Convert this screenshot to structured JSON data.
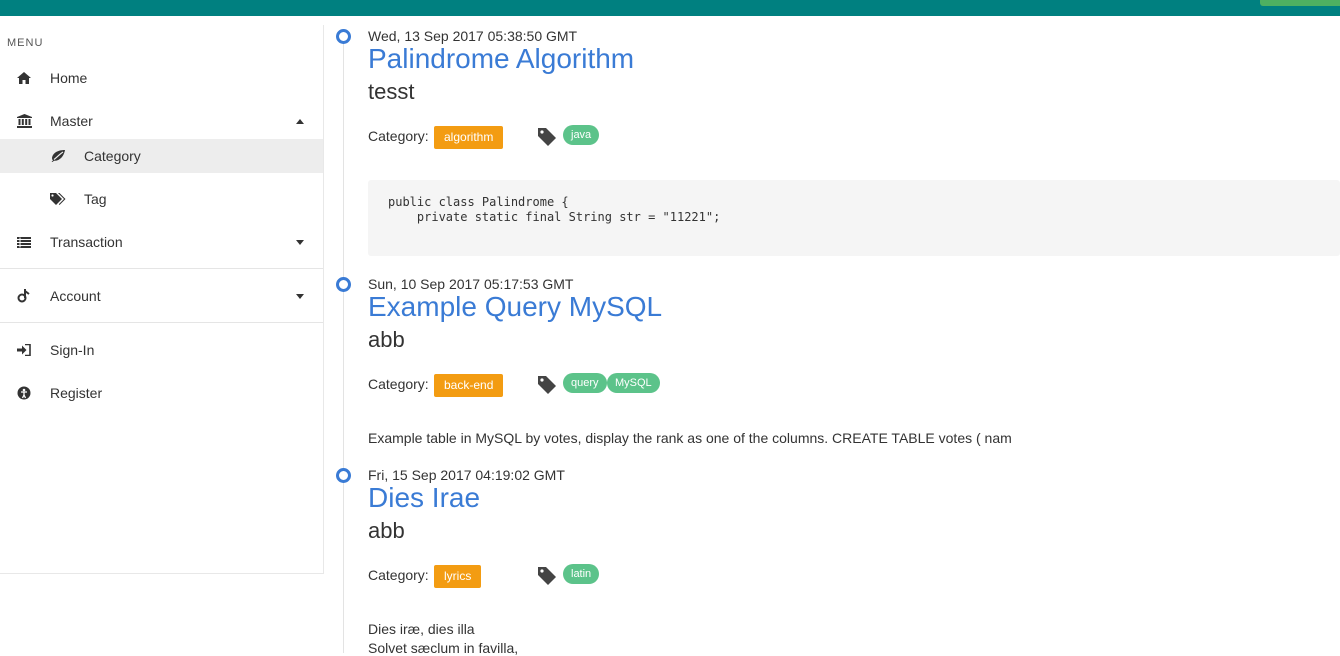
{
  "sidebar": {
    "menu_header": "MENU",
    "items": [
      {
        "label": "Home",
        "icon": "home-icon"
      },
      {
        "label": "Master",
        "icon": "bank-icon"
      },
      {
        "label": "Category",
        "icon": "leaf-icon"
      },
      {
        "label": "Tag",
        "icon": "tags-icon"
      },
      {
        "label": "Transaction",
        "icon": "list-icon"
      },
      {
        "label": "Account",
        "icon": "account-icon"
      },
      {
        "label": "Sign-In",
        "icon": "sign-in-icon"
      },
      {
        "label": "Register",
        "icon": "register-icon"
      }
    ]
  },
  "posts": [
    {
      "date": "Wed, 13 Sep 2017 05:38:50 GMT",
      "title": "Palindrome Algorithm",
      "subtitle": "tesst",
      "category_label": "Category:",
      "category": "algorithm",
      "tags": [
        "java"
      ],
      "code": "public class Palindrome {\n    private static final String str = \"11221\";"
    },
    {
      "date": "Sun, 10 Sep 2017 05:17:53 GMT",
      "title": "Example Query MySQL",
      "subtitle": "abb",
      "category_label": "Category:",
      "category": "back-end",
      "tags": [
        "query",
        "MySQL"
      ],
      "excerpt": "Example table in MySQL by votes, display the rank as one of the columns. CREATE TABLE votes ( nam"
    },
    {
      "date": "Fri, 15 Sep 2017 04:19:02 GMT",
      "title": "Dies Irae",
      "subtitle": "abb",
      "category_label": "Category:",
      "category": "lyrics",
      "tags": [
        "latin"
      ],
      "excerpt_lines": [
        "Dies iræ, dies illa",
        "Solvet sæclum in favilla,"
      ]
    }
  ],
  "colors": {
    "header": "#008080",
    "accent": "#3a7bd5",
    "category_badge": "#f39c12",
    "tag_pill": "#5cc38a"
  }
}
